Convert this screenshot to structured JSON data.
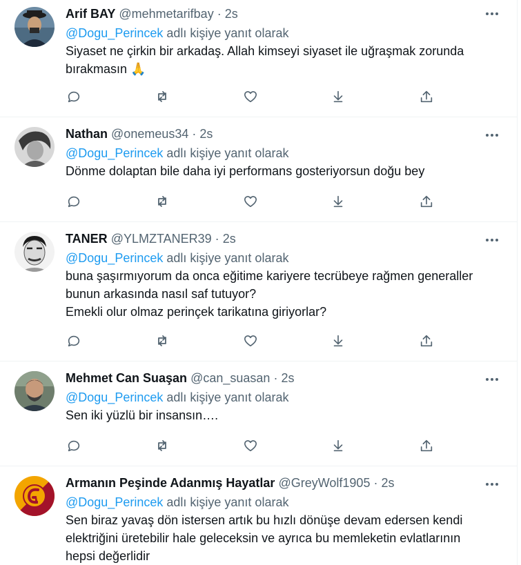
{
  "reply_prefix": "adlı kişiyle yanıt olarak",
  "tweets": [
    {
      "name": "Arif BAY",
      "handle": "@mehmetarifbay",
      "time": "2s",
      "mention": "@Dogu_Perincek",
      "reply_text": "adlı kişiye yanıt olarak",
      "lines": [
        "Siyaset ne çirkin bir arkadaş. Allah kimseyi siyaset ile uğraşmak zorunda",
        "bırakmasın 🙏"
      ],
      "avatar_color": "#5a7a93"
    },
    {
      "name": "Nathan",
      "handle": "@onemeus34",
      "time": "2s",
      "mention": "@Dogu_Perincek",
      "reply_text": "adlı kişiye yanıt olarak",
      "lines": [
        "Dönme dolaptan bile daha iyi performans gosteriyorsun doğu bey"
      ],
      "avatar_color": "#9a9a9a"
    },
    {
      "name": "TANER",
      "handle": "@YLMZTANER39",
      "time": "2s",
      "mention": "@Dogu_Perincek",
      "reply_text": "adlı kişiye yanıt olarak",
      "lines": [
        "buna şaşırmıyorum da onca eğitime kariyere tecrübeye rağmen generaller",
        "bunun arkasında nasıl saf tutuyor?",
        "Emekli olur olmaz perinçek tarikatına giriyorlar?"
      ],
      "avatar_color": "#e6e6e6"
    },
    {
      "name": "Mehmet Can Suaşan",
      "handle": "@can_suasan",
      "time": "2s",
      "mention": "@Dogu_Perincek",
      "reply_text": "adlı kişiye yanıt olarak",
      "lines": [
        "Sen iki yüzlü bir insansın…."
      ],
      "avatar_color": "#4f5e50"
    },
    {
      "name": "Armanın Peşinde Adanmış Hayatlar",
      "handle": "@GreyWolf1905",
      "time": "2s",
      "mention": "@Dogu_Perincek",
      "reply_text": "adlı kişiye yanıt olarak",
      "lines": [
        "Sen biraz yavaş dön istersen artık bu hızlı dönüşe devam edersen kendi",
        "elektriğini üretebilir hale geleceksin ve ayrıca bu memleketin evlatlarının",
        "hepsi değerlidir"
      ],
      "avatar_color": "#f6a800"
    }
  ],
  "icons": {
    "more": "more-icon",
    "reply": "reply-icon",
    "retweet": "retweet-icon",
    "like": "like-icon",
    "download": "download-icon",
    "share": "share-icon"
  },
  "colors": {
    "accent": "#1d9bf0",
    "muted": "#536471",
    "text": "#0f1419",
    "divider": "#eff3f4"
  }
}
